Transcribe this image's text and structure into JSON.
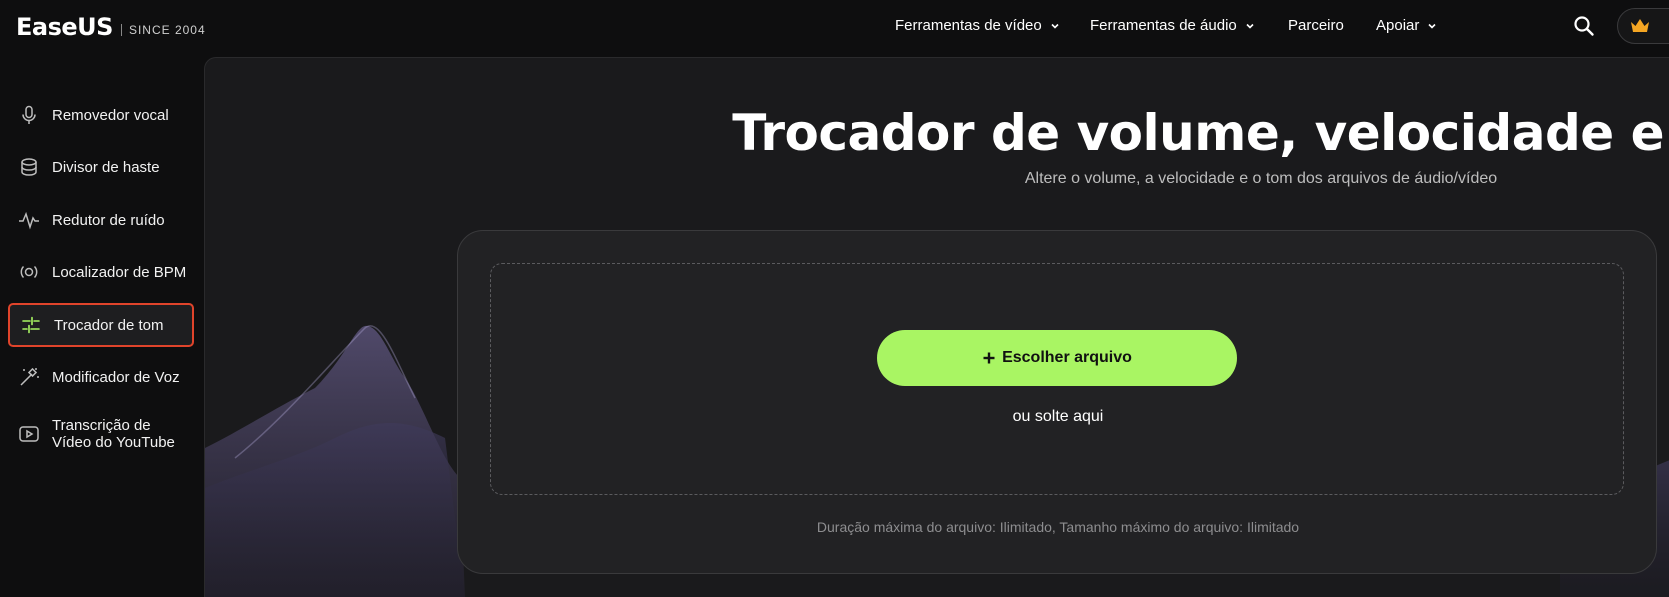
{
  "header": {
    "logo_text": "EaseUS",
    "logo_since": "SINCE 2004",
    "nav": [
      {
        "label": "Ferramentas de vídeo",
        "has_dropdown": true
      },
      {
        "label": "Ferramentas de áudio",
        "has_dropdown": true
      },
      {
        "label": "Parceiro",
        "has_dropdown": false
      },
      {
        "label": "Apoiar",
        "has_dropdown": true
      }
    ],
    "search_icon": "search-icon",
    "account_icon": "crown-icon"
  },
  "sidebar": {
    "items": [
      {
        "label": "Removedor vocal",
        "icon": "microphone-icon",
        "active": false
      },
      {
        "label": "Divisor de haste",
        "icon": "stack-icon",
        "active": false
      },
      {
        "label": "Redutor de ruído",
        "icon": "waveform-icon",
        "active": false
      },
      {
        "label": "Localizador de BPM",
        "icon": "radio-wave-icon",
        "active": false
      },
      {
        "label": "Trocador de tom",
        "icon": "sliders-icon",
        "active": true
      },
      {
        "label": "Modificador de Voz",
        "icon": "magic-wand-icon",
        "active": false
      },
      {
        "label": "Transcrição de Vídeo do YouTube",
        "label_line1": "Transcrição de",
        "label_line2": "Vídeo do YouTube",
        "icon": "video-play-icon",
        "active": false
      }
    ]
  },
  "main": {
    "title": "Trocador de volume, velocidade e tom",
    "subtitle": "Altere o volume, a velocidade e o tom dos arquivos de áudio/vídeo",
    "upload": {
      "button_label": "Escolher arquivo",
      "drop_hint": "ou solte aqui",
      "limits": "Duração máxima do arquivo: Ilimitado, Tamanho máximo do arquivo: Ilimitado"
    }
  },
  "colors": {
    "accent_green": "#a9f563",
    "active_border": "#e0442b",
    "background": "#0e0e0f",
    "crown": "#f5a623"
  }
}
